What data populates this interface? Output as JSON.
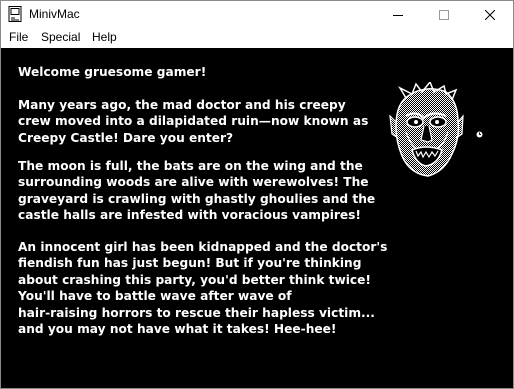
{
  "window": {
    "title": "MinivMac",
    "controls": {
      "minimize": "minimize",
      "maximize": "maximize",
      "close": "close"
    }
  },
  "menu": {
    "items": [
      "File",
      "Special",
      "Help"
    ]
  },
  "game": {
    "greeting": "Welcome gruesome gamer!",
    "paragraph1": [
      "Many years ago, the mad doctor and his creepy",
      "crew moved into a dilapidated ruin—now known as",
      "Creepy Castle! Dare you enter?"
    ],
    "paragraph2": [
      "The moon is full, the bats are on the wing and the",
      "surrounding woods are alive with werewolves! The",
      "graveyard is crawling with ghastly ghoulies and the",
      "castle halls are infested with voracious vampires!"
    ],
    "paragraph3": [
      "An innocent girl has been kidnapped and the doctor's",
      "fiendish fun has just begun! But if you're thinking",
      "about crashing this party, you'd better think twice!",
      "You'll have to battle wave after wave of",
      "hair-raising horrors to rescue their hapless victim...",
      "and you may not have what it takes! Hee-hee!"
    ]
  },
  "icons": {
    "app": "mac-app-icon",
    "face": "ghoul-face-icon",
    "cursor": "watch-cursor-icon"
  },
  "colors": {
    "screen_background": "#000000",
    "screen_text": "#ffffff",
    "chrome_background": "#ffffff"
  }
}
